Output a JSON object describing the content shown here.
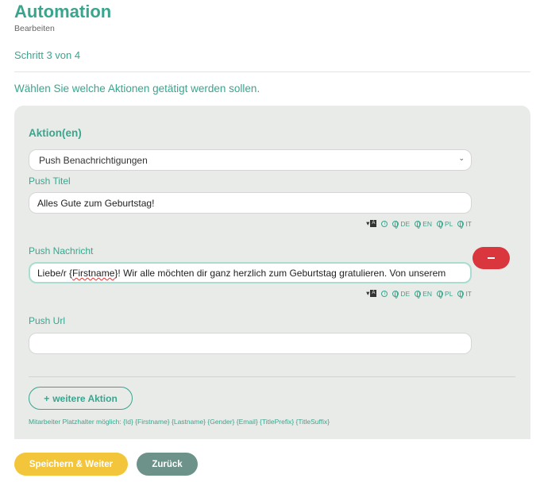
{
  "header": {
    "title": "Automation",
    "subtitle": "Bearbeiten",
    "step": "Schritt 3 von 4",
    "intro": "Wählen Sie welche Aktionen getätigt werden sollen."
  },
  "actions": {
    "section_title": "Aktion(en)",
    "action_type": "Push Benachrichtigungen",
    "push_title_label": "Push Titel",
    "push_title_value": "Alles Gute zum Geburtstag!",
    "push_message_label": "Push Nachricht",
    "push_message_prefix": "Liebe/r {",
    "push_message_placeholder": "Firstname",
    "push_message_suffix": "}! Wir alle möchten dir ganz herzlich zum Geburtstag gratulieren. Von unserem",
    "push_url_label": "Push Url",
    "push_url_value": "",
    "translate_label": "A",
    "info_label": "i",
    "languages": [
      "DE",
      "EN",
      "PL",
      "IT"
    ],
    "add_action_label": "weitere Aktion",
    "placeholder_hint": "Mitarbeiter Platzhalter möglich: {Id} {Firstname} {Lastname} {Gender} {Email} {TitlePrefix} {TitleSuffix}"
  },
  "footer": {
    "save_label": "Speichern & Weiter",
    "back_label": "Zurück"
  },
  "colors": {
    "accent": "#3aa58e",
    "danger": "#d9363e",
    "primary_button": "#f3c53b",
    "secondary_button": "#6d928a",
    "panel": "#e9ebe8"
  }
}
